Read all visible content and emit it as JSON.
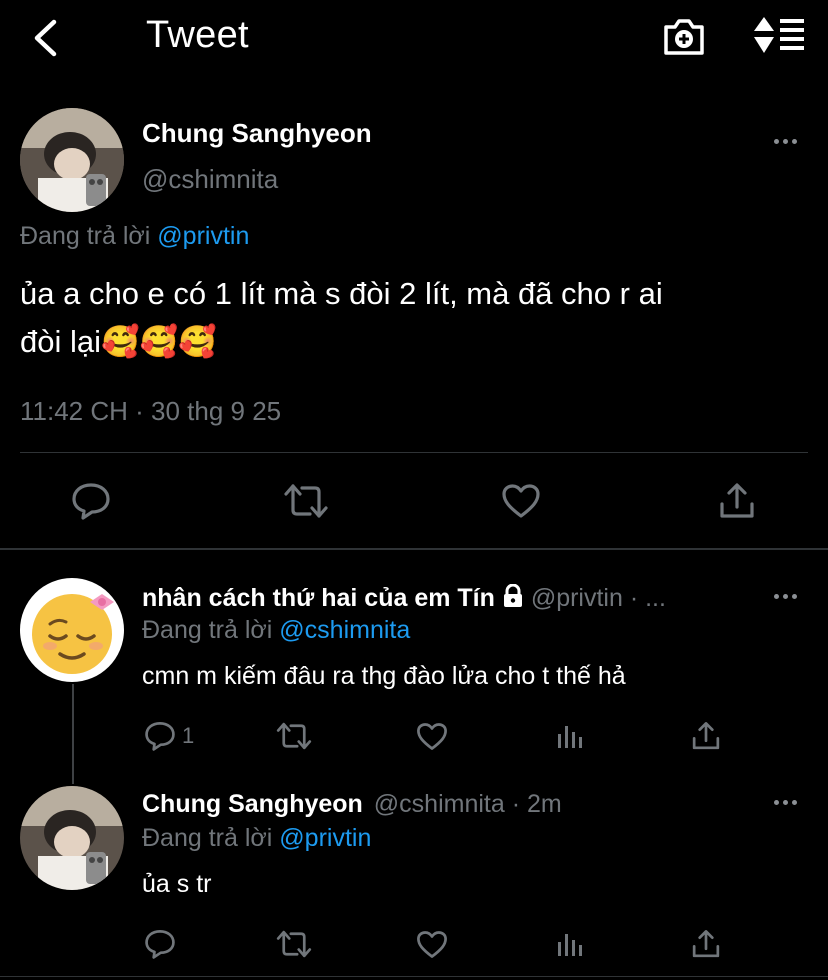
{
  "header": {
    "title": "Tweet",
    "back_icon": "chevron-left-icon",
    "camera_icon": "camera-add-icon",
    "sort_icon": "sort-lines-icon"
  },
  "main_tweet": {
    "author_name": "Chung Sanghyeon",
    "author_handle": "@cshimnita",
    "replying_prefix": "Đang trả lời",
    "replying_to": "@privtin",
    "text_line1": "ủa a cho e có 1 lít mà s đòi 2 lít, mà đã cho r ai",
    "text_line2": "đòi lại🥰🥰🥰",
    "timestamp": "11:42 CH · 30 thg 9 25"
  },
  "replies": [
    {
      "author_name": "nhân cách thứ hai của em Tín",
      "author_handle": "@privtin · ...",
      "replying_prefix": "Đang trả lời",
      "replying_to": "@cshimnita",
      "text": "cmn m kiếm đâu ra thg đào lửa cho t thế hả",
      "reply_count": "1",
      "avatar_emoji": "😌🎀"
    },
    {
      "author_name": "Chung Sanghyeon",
      "author_handle": "@cshimnita · 2m",
      "replying_prefix": "Đang trả lời",
      "replying_to": "@privtin",
      "text": "ủa s tr",
      "reply_count": ""
    }
  ],
  "colors": {
    "background": "#000000",
    "text": "#e7e9ea",
    "muted": "#71767b",
    "link": "#1d9bf0",
    "divider": "#2f3336"
  }
}
